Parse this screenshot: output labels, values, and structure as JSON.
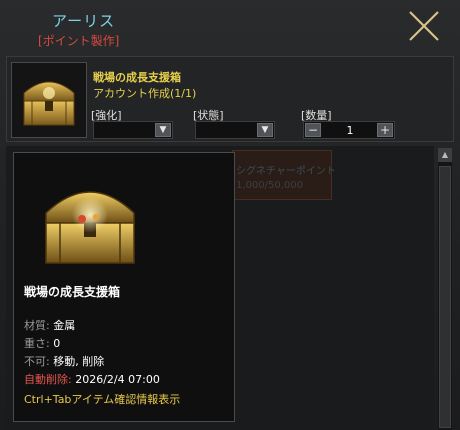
{
  "header": {
    "title": "アーリス",
    "subtitle": "[ポイント製作]",
    "close_icon": "close-x-icon"
  },
  "item": {
    "name": "戦場の成長支援箱",
    "limit": "アカウント作成(1/1)",
    "thumb_icon": "treasure-chest-icon"
  },
  "fields": {
    "enhance_label": "[強化]",
    "state_label": "[状態]",
    "quantity_label": "[数量]",
    "enhance_value": "",
    "state_value": "",
    "quantity_value": "1"
  },
  "list_bg": {
    "line1": "シグネチャーポイント",
    "line2": "1,000/50,000"
  },
  "tooltip": {
    "title": "戦場の成長支援箱",
    "material_key": "材質:",
    "material_val": "金属",
    "weight_key": "重さ:",
    "weight_val": "0",
    "restrict_key": "不可:",
    "restrict_val": "移動, 削除",
    "autodelete_key": "自動削除:",
    "autodelete_val": "2026/2/4 07:00",
    "hint": "Ctrl+Tabアイテム確認情報表示"
  },
  "colors": {
    "title": "#7ed3e6",
    "subtitle": "#d64a3f",
    "item_name": "#e7d14a",
    "close_icon": "#d9c08a"
  }
}
